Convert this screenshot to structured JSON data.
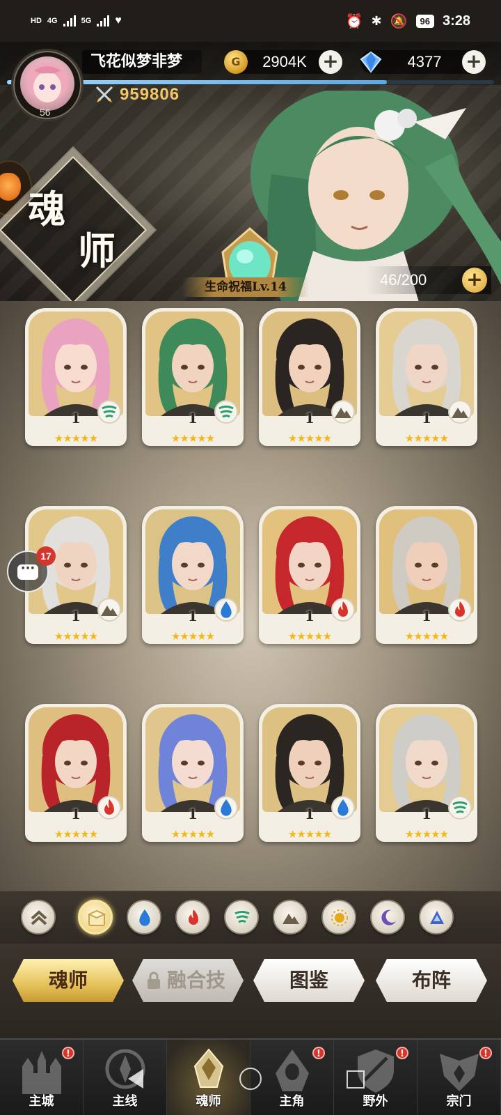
{
  "status_bar": {
    "network_left": "HD",
    "network_4g": "4G",
    "network_5g": "5G",
    "battery": "96",
    "time": "3:28"
  },
  "header": {
    "player_name": "飞花似梦非梦",
    "player_level": "56",
    "coins": "2904K",
    "gems": "4377",
    "power": "959806",
    "exp_progress": 0.78
  },
  "banner": {
    "title_line1": "魂",
    "title_line2": "师",
    "blessing_label": "生命祝福Lv.14",
    "roster_count": "46/200"
  },
  "heroes": [
    {
      "level": "1",
      "element": "wind",
      "stars": "★★★★★",
      "hair": "#e9a2bf",
      "skin": "#f8dccf",
      "bg": "#e3c78a"
    },
    {
      "level": "1",
      "element": "wind",
      "stars": "★★★★★",
      "hair": "#3f8a5a",
      "skin": "#f1d4c0",
      "bg": "#e1c383"
    },
    {
      "level": "1",
      "element": "earth",
      "stars": "★★★★★",
      "hair": "#2a2522",
      "skin": "#f0d2bd",
      "bg": "#dcbf80"
    },
    {
      "level": "1",
      "element": "earth",
      "stars": "★★★★★",
      "hair": "#d9d6d0",
      "skin": "#f0d6c6",
      "bg": "#e5cc93"
    },
    {
      "level": "1",
      "element": "earth",
      "stars": "★★★★★",
      "hair": "#e2e0dc",
      "skin": "#f0d4c2",
      "bg": "#e2c78a"
    },
    {
      "level": "1",
      "element": "water",
      "stars": "★★★★★",
      "hair": "#3f7fc9",
      "skin": "#f1d8c8",
      "bg": "#dbc286"
    },
    {
      "level": "1",
      "element": "fire",
      "stars": "★★★★★",
      "hair": "#c6272c",
      "skin": "#f2d5c4",
      "bg": "#e2c27c"
    },
    {
      "level": "1",
      "element": "fire",
      "stars": "★★★★★",
      "hair": "#cfcac2",
      "skin": "#efcfba",
      "bg": "#e0c07d"
    },
    {
      "level": "1",
      "element": "fire",
      "stars": "★★★★★",
      "hair": "#b9232a",
      "skin": "#f3d6c3",
      "bg": "#dfbf7f"
    },
    {
      "level": "1",
      "element": "water",
      "stars": "★★★★★",
      "hair": "#6f84d8",
      "skin": "#f4dcd2",
      "bg": "#e0c68c"
    },
    {
      "level": "1",
      "element": "water",
      "stars": "★★★★★",
      "hair": "#2b2621",
      "skin": "#efd1bb",
      "bg": "#ddc183"
    },
    {
      "level": "1",
      "element": "wind",
      "stars": "★★★★★",
      "hair": "#cfcdc8",
      "skin": "#f2dacb",
      "bg": "#e4cb92"
    },
    {
      "level": "",
      "element": "",
      "stars": "",
      "hair": "#e69ab8",
      "skin": "#f9e0d4",
      "bg": "#e3c68b"
    },
    {
      "level": "",
      "element": "",
      "stars": "",
      "hair": "#e69ab8",
      "skin": "#f9e0d4",
      "bg": "#e3c68b"
    },
    {
      "level": "",
      "element": "",
      "stars": "",
      "hair": "#d6d6e0",
      "skin": "#f2dbd6",
      "bg": "#dec185"
    },
    {
      "level": "",
      "element": "",
      "stars": "",
      "hair": "#1f1c1a",
      "skin": "#efd2be",
      "bg": "#e1c587"
    }
  ],
  "chat": {
    "unread": "17"
  },
  "filters": [
    {
      "name": "rank-up",
      "icon": "chevron-up-icon"
    },
    {
      "name": "all",
      "icon": "box-icon"
    },
    {
      "name": "water",
      "icon": "water-drop-icon"
    },
    {
      "name": "fire",
      "icon": "fire-icon"
    },
    {
      "name": "wind",
      "icon": "wind-icon"
    },
    {
      "name": "earth",
      "icon": "mountain-icon"
    },
    {
      "name": "light",
      "icon": "sun-icon"
    },
    {
      "name": "dark",
      "icon": "moon-icon"
    },
    {
      "name": "special",
      "icon": "triangle-icon"
    }
  ],
  "tabs": [
    {
      "label": "魂师"
    },
    {
      "label": "融合技"
    },
    {
      "label": "图鉴"
    },
    {
      "label": "布阵"
    }
  ],
  "nav": [
    {
      "label": "主城",
      "dot": "!"
    },
    {
      "label": "主线",
      "dot": ""
    },
    {
      "label": "魂师",
      "dot": ""
    },
    {
      "label": "主角",
      "dot": "!"
    },
    {
      "label": "野外",
      "dot": "!"
    },
    {
      "label": "宗门",
      "dot": "!"
    }
  ],
  "colors": {
    "accent_gold": "#f3c766",
    "star_gold": "#f2b619",
    "fire": "#d8342a",
    "water": "#2a7ad8",
    "wind": "#2aa071",
    "earth": "#6b5e4a"
  }
}
